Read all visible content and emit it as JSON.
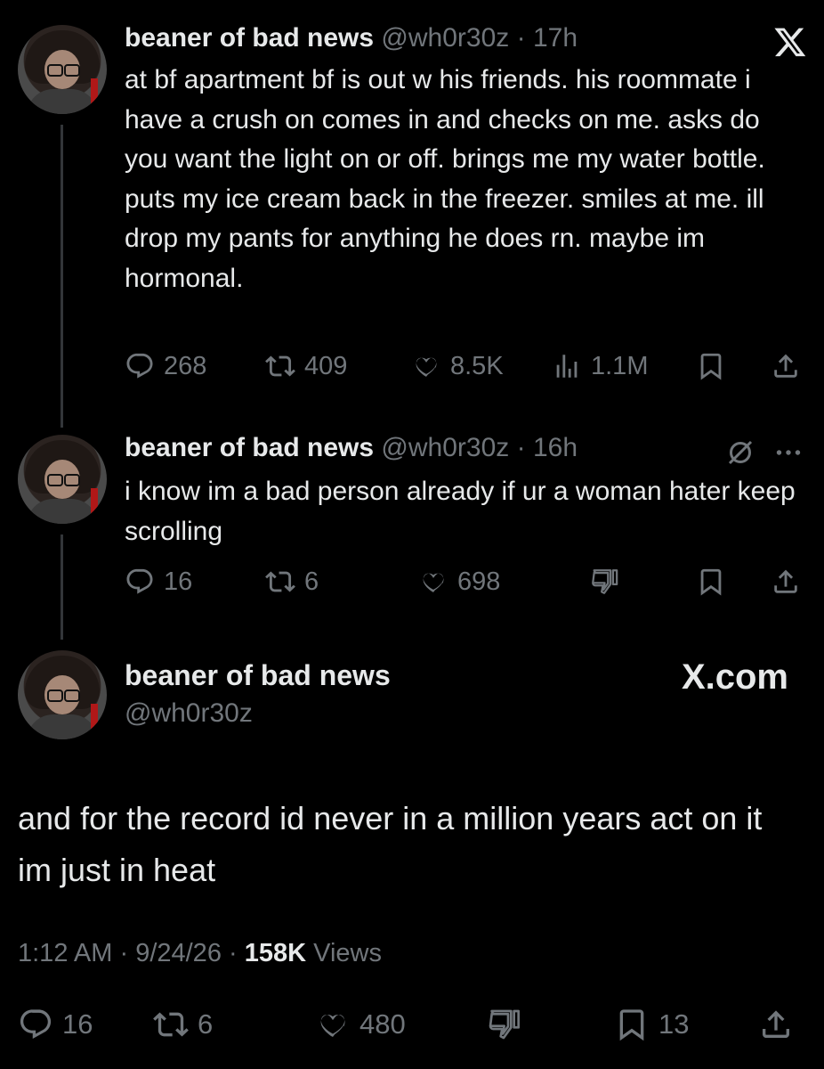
{
  "close_button": {
    "icon": "x-close-icon"
  },
  "tweets": [
    {
      "name": "beaner of bad news",
      "handle": "@wh0r30z",
      "time": "17h",
      "text": "at bf apartment bf is out w his friends. his roommate i have a crush on comes in and checks on me. asks do you want the light on or off. brings me my water bottle. puts my ice cream back in the freezer. smiles at me. ill drop my pants for anything he does rn. maybe im hormonal.",
      "replies": "268",
      "reposts": "409",
      "likes": "8.5K",
      "views": "1.1M"
    },
    {
      "name": "beaner of bad news",
      "handle": "@wh0r30z",
      "time": "16h",
      "text": "i know im a bad person already if ur a woman hater keep scrolling",
      "replies": "16",
      "reposts": "6",
      "likes": "698"
    }
  ],
  "main_tweet": {
    "name": "beaner of bad news",
    "handle": "@wh0r30z",
    "brand": "X.com",
    "text": "and for the record id never in a million years act on it im just in heat",
    "time": "1:12 AM",
    "date": "9/24/26",
    "views_count": "158K",
    "views_label": "Views",
    "replies": "16",
    "reposts": "6",
    "likes": "480",
    "bookmarks": "13"
  },
  "colors": {
    "background": "#000000",
    "text": "#e7e9ea",
    "muted": "#71767b",
    "line": "#333639"
  }
}
